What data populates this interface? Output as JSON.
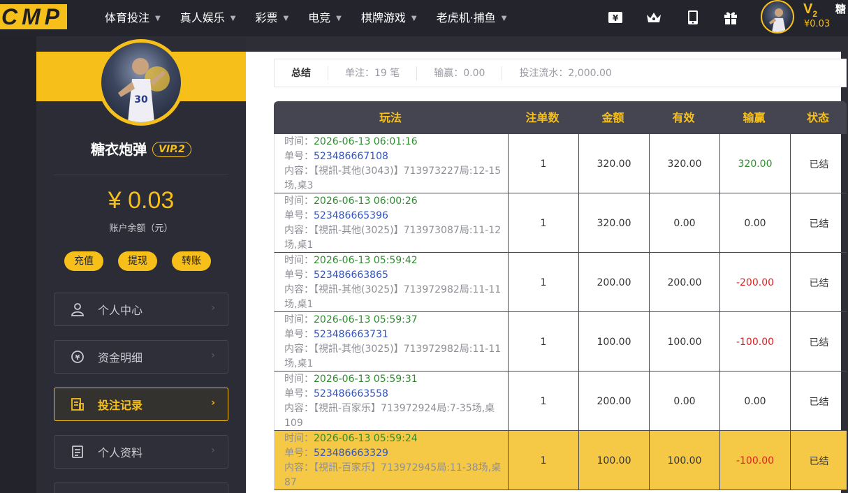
{
  "logo": "CMP",
  "nav": [
    "体育投注",
    "真人娱乐",
    "彩票",
    "电竞",
    "棋牌游戏",
    "老虎机·捕鱼"
  ],
  "top_icons": [
    "yuan-ticket-icon",
    "crown-icon",
    "phone-icon",
    "gift-icon"
  ],
  "top_user": {
    "vip": "V",
    "vip_level": "2",
    "balance": "¥0.03",
    "name": "糖"
  },
  "user": {
    "name": "糖衣炮弹",
    "vip": "VIP.2",
    "balance": "¥ 0.03",
    "balance_label": "账户余额（元）"
  },
  "actions": [
    "充值",
    "提现",
    "转账"
  ],
  "menu": [
    {
      "label": "个人中心",
      "icon": "user-icon"
    },
    {
      "label": "资金明细",
      "icon": "exchange-icon"
    },
    {
      "label": "投注记录",
      "icon": "bet-record-icon"
    },
    {
      "label": "个人资料",
      "icon": "profile-doc-icon"
    }
  ],
  "summary": {
    "title": "总结",
    "count": "单注：19 笔",
    "winloss": "输赢：0.00",
    "turnover": "投注流水：2,000.00"
  },
  "table": {
    "headers": [
      "玩法",
      "注单数",
      "金额",
      "有效",
      "输赢",
      "状态"
    ],
    "label_time": "时间：",
    "label_order": "单号：",
    "label_content": "内容：",
    "rows": [
      {
        "time": "2026-06-13 06:01:16",
        "order": "523486667108",
        "content": "【視訊-其他(3043)】713973227局:12-15场,桌3",
        "count": "1",
        "amount": "320.00",
        "valid": "320.00",
        "winloss": "320.00",
        "status": "已结",
        "sign": "pos"
      },
      {
        "time": "2026-06-13 06:00:26",
        "order": "523486665396",
        "content": "【視訊-其他(3025)】713973087局:11-12场,桌1",
        "count": "1",
        "amount": "320.00",
        "valid": "0.00",
        "winloss": "0.00",
        "status": "已结",
        "sign": "zero"
      },
      {
        "time": "2026-06-13 05:59:42",
        "order": "523486663865",
        "content": "【視訊-其他(3025)】713972982局:11-11场,桌1",
        "count": "1",
        "amount": "200.00",
        "valid": "200.00",
        "winloss": "-200.00",
        "status": "已结",
        "sign": "neg"
      },
      {
        "time": "2026-06-13 05:59:37",
        "order": "523486663731",
        "content": "【視訊-其他(3025)】713972982局:11-11场,桌1",
        "count": "1",
        "amount": "100.00",
        "valid": "100.00",
        "winloss": "-100.00",
        "status": "已结",
        "sign": "neg"
      },
      {
        "time": "2026-06-13 05:59:31",
        "order": "523486663558",
        "content": "【視訊-百家乐】713972924局:7-35场,桌109",
        "count": "1",
        "amount": "200.00",
        "valid": "0.00",
        "winloss": "0.00",
        "status": "已结",
        "sign": "zero"
      },
      {
        "time": "2026-06-13 05:59:24",
        "order": "523486663329",
        "content": "【視訊-百家乐】713972945局:11-38场,桌87",
        "count": "1",
        "amount": "100.00",
        "valid": "100.00",
        "winloss": "-100.00",
        "status": "已结",
        "sign": "neg",
        "highlight": true
      }
    ]
  }
}
